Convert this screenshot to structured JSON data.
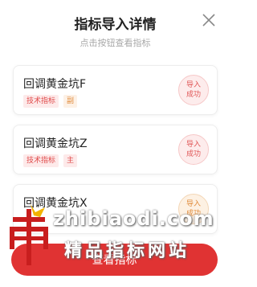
{
  "header": {
    "title": "指标导入详情",
    "subtitle": "点击按钮查看指标"
  },
  "items": [
    {
      "name": "回调黄金坑F",
      "tags": [
        "技术指标",
        "副"
      ],
      "status_line1": "导入",
      "status_line2": "成功"
    },
    {
      "name": "回调黄金坑Z",
      "tags": [
        "技术指标",
        "主"
      ],
      "status_line1": "导入",
      "status_line2": "成功"
    },
    {
      "name": "回调黄金坑X",
      "tags": [],
      "status_line1": "导入",
      "status_line2": "成功"
    }
  ],
  "footer": {
    "button_label": "查看指标"
  },
  "watermark": {
    "url": "zhibiaodi.com",
    "slogan": "精品指标网站",
    "logo_char": "帝"
  },
  "colors": {
    "accent_red": "#e03333",
    "tag_red": "#e04a4a",
    "tag_orange": "#e08a3a"
  },
  "icons": {
    "close": "close-icon"
  }
}
